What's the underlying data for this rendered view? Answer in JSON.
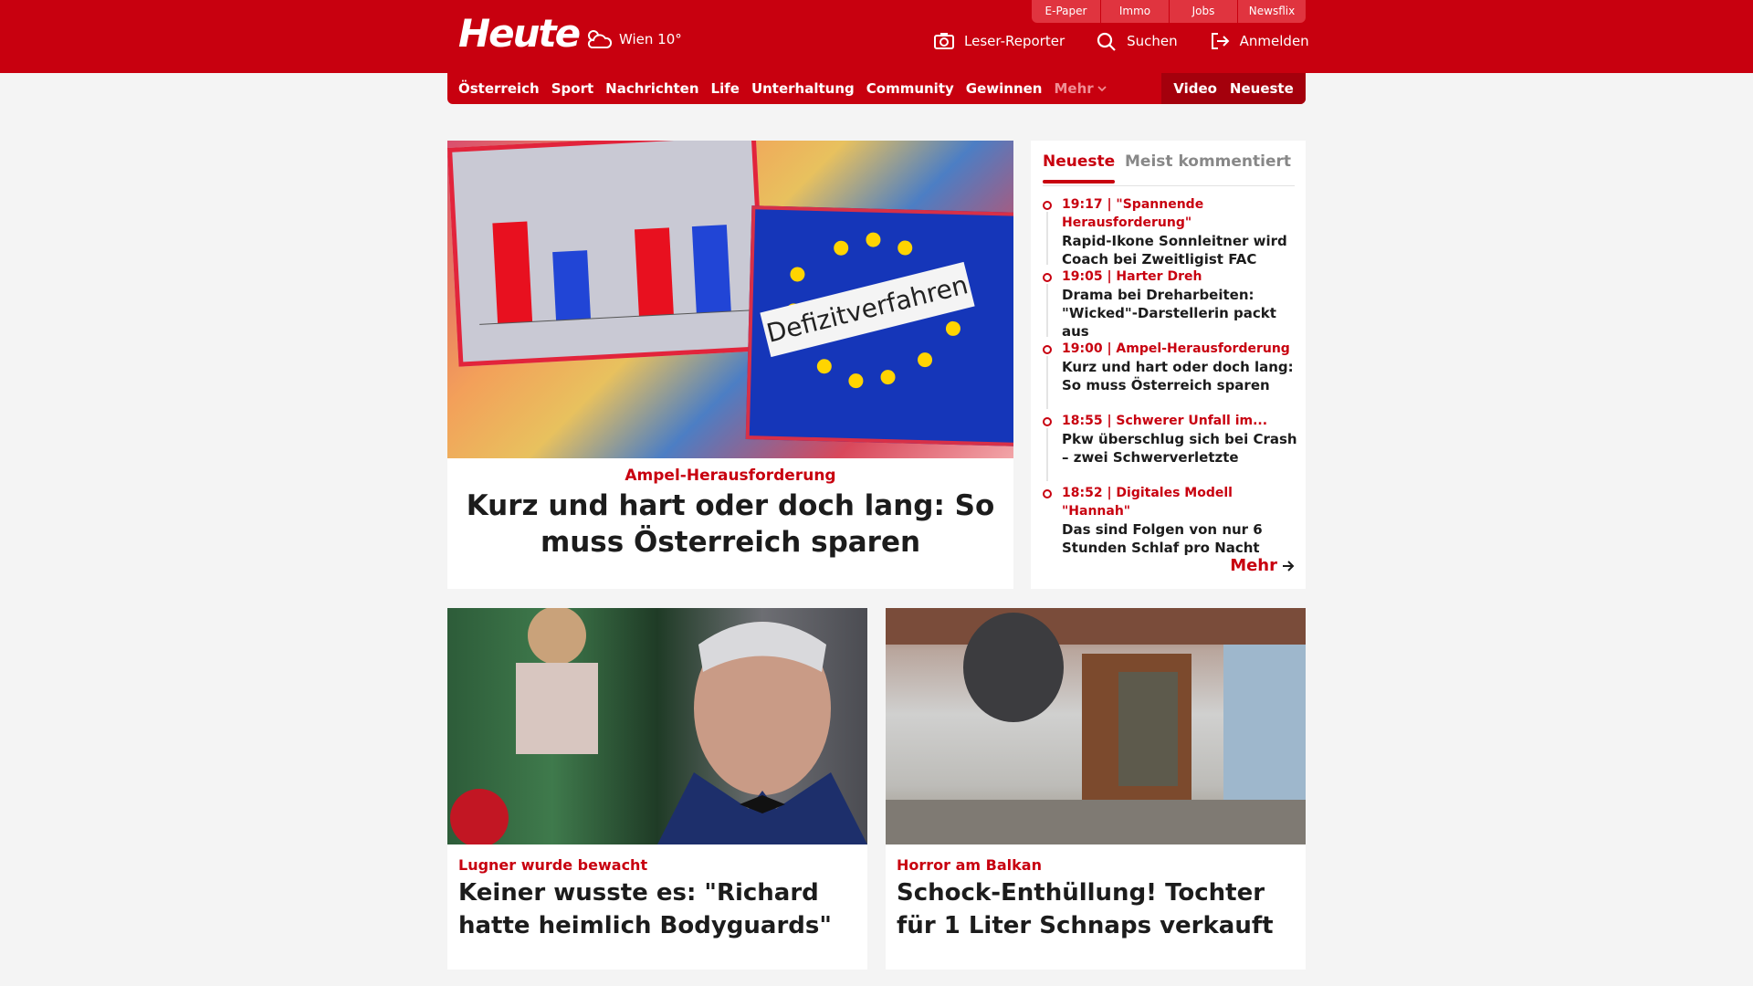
{
  "header": {
    "logo": "Heute",
    "weather": "Wien 10°",
    "quicklinks": [
      "E-Paper",
      "Immo",
      "Jobs",
      "Newsflix"
    ],
    "actions": {
      "reporter": "Leser-Reporter",
      "search": "Suchen",
      "login": "Anmelden"
    }
  },
  "nav": {
    "items": [
      "Österreich",
      "Sport",
      "Nachrichten",
      "Life",
      "Unterhaltung",
      "Community",
      "Gewinnen"
    ],
    "more": "Mehr",
    "video": "Video",
    "latest": "Neueste"
  },
  "hero": {
    "kicker": "Ampel-Herausforderung",
    "title": "Kurz und hart oder doch lang: So muss Österreich sparen",
    "image_text": "Defizitverfahren"
  },
  "sidebar": {
    "tab_active": "Neueste",
    "tab_inactive": "Meist kommentiert",
    "items": [
      {
        "head": "19:17 | \"Spannende Herausforderung\"",
        "title": "Rapid-Ikone Sonnleitner wird Coach bei Zweitligist FAC"
      },
      {
        "head": "19:05 | Harter Dreh",
        "title": "Drama bei Dreharbeiten: \"Wicked\"-Darstellerin packt aus"
      },
      {
        "head": "19:00 | Ampel-Herausforderung",
        "title": "Kurz und hart oder doch lang: So muss Österreich sparen"
      },
      {
        "head": "18:55 | Schwerer Unfall im...",
        "title": "Pkw überschlug sich bei Crash – zwei Schwerverletzte"
      },
      {
        "head": "18:52 | Digitales Modell \"Hannah\"",
        "title": "Das sind Folgen von nur 6 Stunden Schlaf pro Nacht"
      }
    ],
    "more": "Mehr"
  },
  "cards": [
    {
      "kicker": "Lugner wurde bewacht",
      "title": "Keiner wusste es: \"Richard hatte heimlich Bodyguards\""
    },
    {
      "kicker": "Horror am Balkan",
      "title": "Schock-Enthüllung! Tochter für 1 Liter Schnaps verkauft"
    }
  ],
  "colors": {
    "brand": "#c8000f"
  }
}
